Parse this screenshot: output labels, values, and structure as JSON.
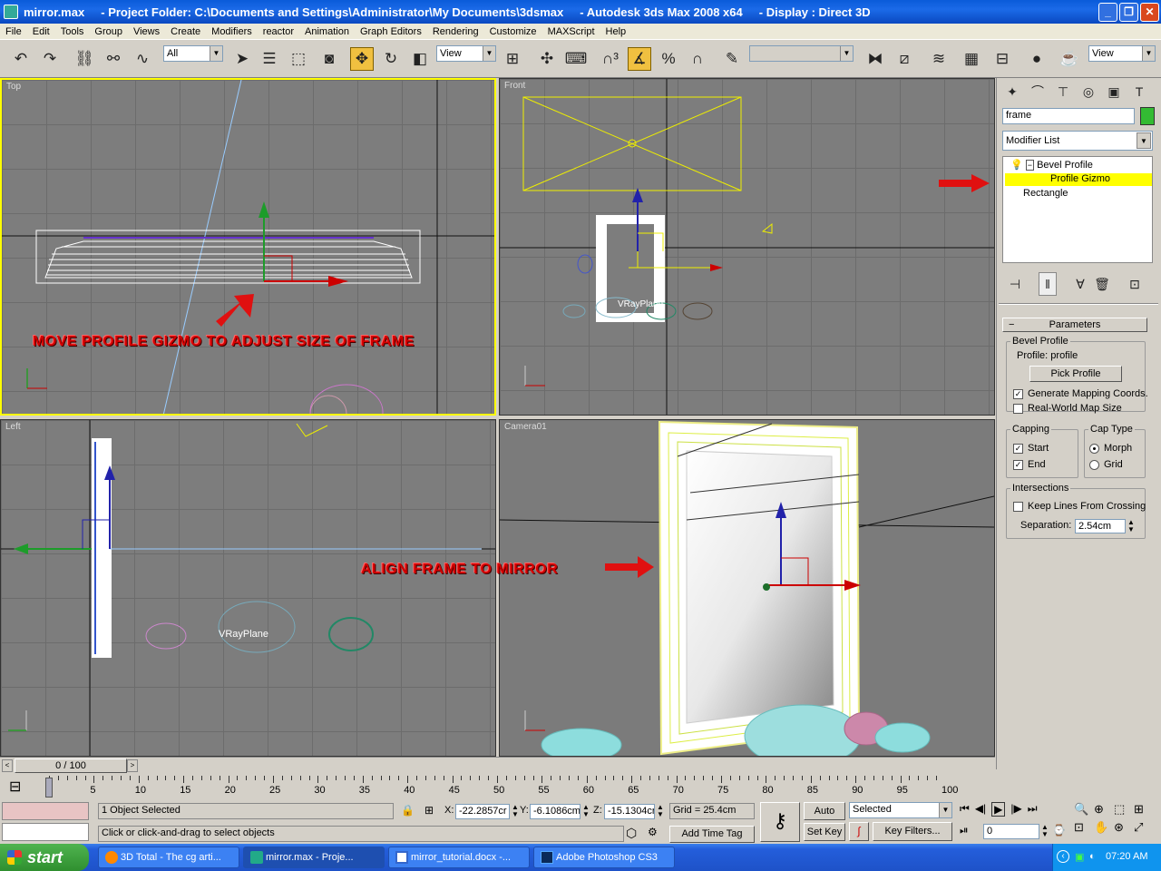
{
  "window": {
    "title": "mirror.max     - Project Folder: C:\\Documents and Settings\\Administrator\\My Documents\\3dsmax     - Autodesk 3ds Max 2008 x64     - Display : Direct 3D"
  },
  "menu": [
    "File",
    "Edit",
    "Tools",
    "Group",
    "Views",
    "Create",
    "Modifiers",
    "reactor",
    "Animation",
    "Graph Editors",
    "Rendering",
    "Customize",
    "MAXScript",
    "Help"
  ],
  "toolbar": {
    "selection_filter": "All",
    "ref_coord": "View",
    "ref_coord2": "View",
    "named_sel": ""
  },
  "viewports": {
    "top": {
      "label": "Top"
    },
    "front": {
      "label": "Front"
    },
    "left": {
      "label": "Left"
    },
    "camera": {
      "label": "Camera01"
    },
    "vray_label": "VRayPlane"
  },
  "annotations": {
    "top": "MOVE PROFILE GIZMO TO ADJUST SIZE OF FRAME",
    "camera": "ALIGN FRAME TO MIRROR"
  },
  "command_panel": {
    "object_name": "frame",
    "object_color": "#33bb33",
    "modifier_list": "Modifier List",
    "stack": [
      "Bevel Profile",
      "Profile Gizmo",
      "Rectangle"
    ],
    "rollout_title": "Parameters",
    "bevel_profile_group": "Bevel Profile",
    "profile_label": "Profile: profile",
    "pick_profile": "Pick Profile",
    "gen_mapping": "Generate Mapping Coords.",
    "real_world": "Real-World Map Size",
    "capping": "Capping",
    "cap_start": "Start",
    "cap_end": "End",
    "cap_type": "Cap Type",
    "morph": "Morph",
    "grid": "Grid",
    "intersections": "Intersections",
    "keep_lines": "Keep Lines From Crossing",
    "separation_label": "Separation:",
    "separation_value": "2.54cm"
  },
  "timeline": {
    "frame_counter": "0 / 100",
    "ticks": [
      "0",
      "5",
      "10",
      "15",
      "20",
      "25",
      "30",
      "35",
      "40",
      "45",
      "50",
      "55",
      "60",
      "65",
      "70",
      "75",
      "80",
      "85",
      "90",
      "95",
      "100"
    ]
  },
  "status": {
    "selected": "1 Object Selected",
    "prompt": "Click or click-and-drag to select objects",
    "x_label": "X:",
    "x": "-22.2857cr",
    "y_label": "Y:",
    "y": "-6.1086cm",
    "z_label": "Z:",
    "z": "-15.1304cr",
    "grid": "Grid = 25.4cm",
    "add_time_tag": "Add Time Tag",
    "auto_key": "Auto Key",
    "set_key": "Set Key",
    "selected_dd": "Selected",
    "key_filters": "Key Filters...",
    "frame": "0"
  },
  "taskbar": {
    "start": "start",
    "tasks": [
      "3D Total - The cg arti...",
      "mirror.max     - Proje...",
      "mirror_tutorial.docx -...",
      "Adobe Photoshop CS3"
    ],
    "clock": "07:20 AM"
  }
}
